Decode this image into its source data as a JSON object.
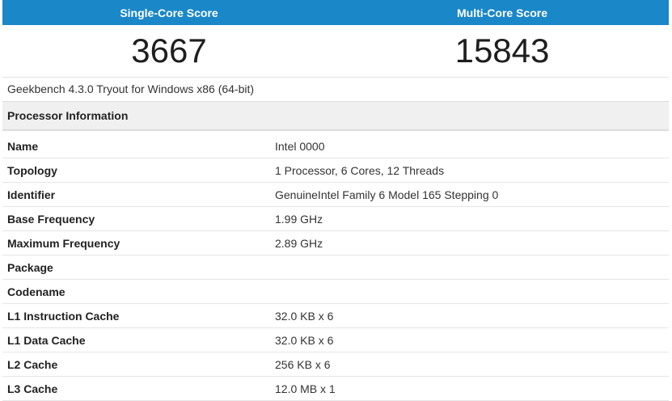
{
  "scores": {
    "single_label": "Single-Core Score",
    "multi_label": "Multi-Core Score",
    "single_value": "3667",
    "multi_value": "15843"
  },
  "version": "Geekbench 4.3.0 Tryout for Windows x86 (64-bit)",
  "processor": {
    "title": "Processor Information",
    "rows": [
      {
        "key": "Name",
        "value": "Intel 0000"
      },
      {
        "key": "Topology",
        "value": "1 Processor, 6 Cores, 12 Threads"
      },
      {
        "key": "Identifier",
        "value": "GenuineIntel Family 6 Model 165 Stepping 0"
      },
      {
        "key": "Base Frequency",
        "value": "1.99 GHz"
      },
      {
        "key": "Maximum Frequency",
        "value": "2.89 GHz"
      },
      {
        "key": "Package",
        "value": ""
      },
      {
        "key": "Codename",
        "value": ""
      },
      {
        "key": "L1 Instruction Cache",
        "value": "32.0 KB x 6"
      },
      {
        "key": "L1 Data Cache",
        "value": "32.0 KB x 6"
      },
      {
        "key": "L2 Cache",
        "value": "256 KB x 6"
      },
      {
        "key": "L3 Cache",
        "value": "12.0 MB x 1"
      }
    ]
  },
  "colors": {
    "header_blue": "#1a87c8",
    "section_bg": "#f0f0f0"
  }
}
